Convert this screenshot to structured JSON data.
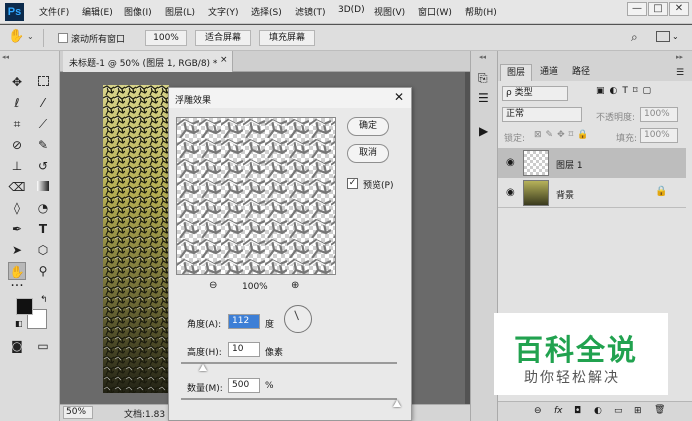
{
  "app": {
    "logo": "Ps"
  },
  "menu": [
    "文件(F)",
    "编辑(E)",
    "图像(I)",
    "图层(L)",
    "文字(Y)",
    "选择(S)",
    "滤镜(T)",
    "3D(D)",
    "视图(V)",
    "窗口(W)",
    "帮助(H)"
  ],
  "window_controls": {
    "minimize": "—",
    "maximize": "□",
    "close": "✕"
  },
  "options": {
    "scroll_all_label": "滚动所有窗口",
    "zoom_button": "100%",
    "fit_screen_button": "适合屏幕",
    "fill_screen_button": "填充屏幕"
  },
  "document": {
    "tab_title": "未标题-1 @ 50% (图层 1, RGB/8) *",
    "tab_close": "×",
    "status_zoom": "50%",
    "status_doc": "文档:1.83"
  },
  "dialog": {
    "title": "浮雕效果",
    "close": "✕",
    "ok_button": "确定",
    "cancel_button": "取消",
    "preview_label": "预览(P)",
    "preview_checked": true,
    "zoom_value": "100%",
    "angle_label": "角度(A):",
    "angle_value": "112",
    "angle_unit": "度",
    "height_label": "高度(H):",
    "height_value": "10",
    "height_unit": "像素",
    "height_slider_fraction": 0.1,
    "amount_label": "数量(M):",
    "amount_value": "500",
    "amount_unit": "%",
    "amount_slider_fraction": 1.0
  },
  "layers_panel": {
    "tabs": [
      "图层",
      "通道",
      "路径"
    ],
    "filter_kind": "ρ 类型",
    "blend_mode": "正常",
    "opacity_label": "不透明度:",
    "opacity_value": "100%",
    "lock_label": "锁定:",
    "fill_label": "填充:",
    "fill_value": "100%",
    "layers": [
      {
        "name": "图层 1",
        "selected": true
      },
      {
        "name": "背景",
        "selected": false
      }
    ],
    "footer_icons": [
      "⊖",
      "fx",
      "◘",
      "◐",
      "▭",
      "⊞",
      "🗑"
    ]
  },
  "watermark": {
    "title": "百科全说",
    "subtitle": "助你轻松解决"
  },
  "colors": {
    "accent": "#31a8ff",
    "watermark_green": "#21a24f"
  }
}
